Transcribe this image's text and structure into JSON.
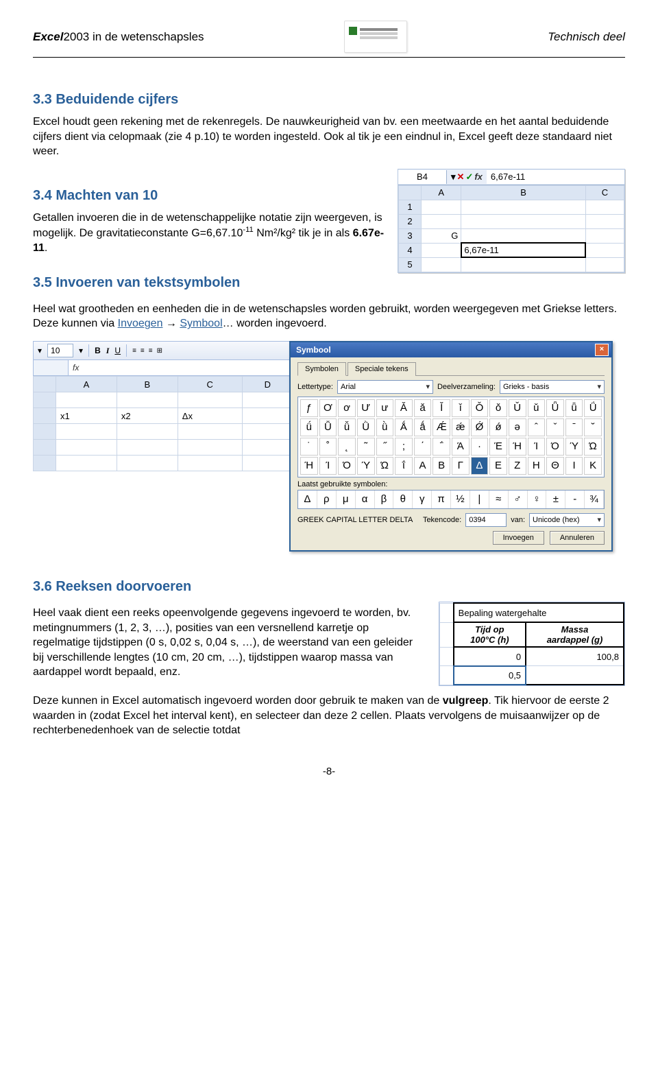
{
  "header": {
    "left_prefix": "Excel",
    "left_year": "2003",
    "left_suffix": " in de wetenschapsles",
    "right": "Technisch deel"
  },
  "sections": {
    "s33_title": "3.3 Beduidende cijfers",
    "s33_p1": "Excel houdt geen rekening met de rekenregels. De nauwkeurigheid van bv. een meetwaarde en het aantal beduidende cijfers dient via celopmaak (zie 4 p.10) te worden ingesteld. Ook al tik je een eindnul in, Excel geeft deze standaard niet weer.",
    "s34_title": "3.4 Machten van 10",
    "s34_p1_a": "Getallen invoeren die in de wetenschappelijke notatie zijn weergeven, is mogelijk. De gravitatieconstante G=6,67.10",
    "s34_p1_sup": "-11",
    "s34_p1_b": " Nm²/kg² tik je in als ",
    "s34_p1_c": "6.67e-11",
    "s34_p1_d": ".",
    "s35_title": "3.5 Invoeren van tekstsymbolen",
    "s35_p1_a": "Heel wat grootheden en eenheden die in de wetenschapsles worden gebruikt, worden weergegeven met Griekse letters. Deze kunnen via ",
    "s35_link1": "Invoegen",
    "s35_arrow": " → ",
    "s35_link2": "Symbool",
    "s35_p1_b": "… worden ingevoerd.",
    "s36_title": "3.6 Reeksen doorvoeren",
    "s36_p1": "Heel vaak dient een reeks opeenvolgende gegevens ingevoerd te worden, bv. metingnummers (1, 2, 3, …), posities van een versnellend karretje op regelmatige tijdstippen (0 s, 0,02 s, 0,04 s, …), de weerstand van een geleider bij verschillende lengtes (10 cm, 20 cm, …), tijdstippen waarop massa van aardappel wordt bepaald, enz.",
    "s36_p2_a": "Deze kunnen in Excel automatisch ingevoerd worden door gebruik te maken van de ",
    "s36_p2_b": "vulgreep",
    "s36_p2_c": ". Tik hiervoor de eerste 2 waarden in (zodat Excel het interval kent), en selecteer dan deze 2 cellen. Plaats vervolgens de muisaanwijzer op de rechterbenedenhoek van de selectie totdat"
  },
  "excel1": {
    "namebox": "B4",
    "formula_value": "6,67e-11",
    "cols": [
      "A",
      "B",
      "C"
    ],
    "rows": [
      "1",
      "2",
      "3",
      "4",
      "5"
    ],
    "cell_a3": "G",
    "cell_b4": "6,67e-11"
  },
  "toolbar": {
    "fontsize": "10",
    "B": "B",
    "I": "I",
    "U": "U",
    "cols": [
      "A",
      "B",
      "C",
      "D"
    ],
    "cell_a": "x1",
    "cell_b": "x2",
    "cell_c": "Δx"
  },
  "dialog": {
    "title": "Symbool",
    "tab1": "Symbolen",
    "tab2": "Speciale tekens",
    "lbl_font": "Lettertype:",
    "val_font": "Arial",
    "lbl_subset": "Deelverzameling:",
    "val_subset": "Grieks - basis",
    "grid": [
      [
        "ƒ",
        "Ơ",
        "ơ",
        "Ư",
        "ư",
        "Ǎ",
        "ǎ",
        "Ǐ",
        "ǐ",
        "Ǒ",
        "ǒ",
        "Ǔ",
        "ǔ",
        "Ǖ",
        "ǖ",
        "Ǘ"
      ],
      [
        "ǘ",
        "Ǚ",
        "ǚ",
        "Ǜ",
        "ǜ",
        "Ǻ",
        "ǻ",
        "Ǽ",
        "ǽ",
        "Ǿ",
        "ǿ",
        "ə",
        "ˆ",
        "ˇ",
        "ˉ",
        "˘"
      ],
      [
        "˙",
        "˚",
        "˛",
        "˜",
        "˝",
        ";",
        "΄",
        "΅",
        "Ά",
        "·",
        "Έ",
        "Ή",
        "Ί",
        "Ό",
        "Ύ",
        "Ώ"
      ],
      [
        "Ή",
        "Ί",
        "Ό",
        "Ύ",
        "Ώ",
        "ΐ",
        "Α",
        "Β",
        "Γ",
        "Δ",
        "Ε",
        "Ζ",
        "Η",
        "Θ",
        "Ι",
        "Κ"
      ]
    ],
    "selected_index": [
      3,
      9
    ],
    "lbl_recent": "Laatst gebruikte symbolen:",
    "recent": [
      "Δ",
      "ρ",
      "μ",
      "α",
      "β",
      "θ",
      "γ",
      "π",
      "½",
      "|",
      "≈",
      "♂",
      "♀",
      "±",
      "-",
      "¾"
    ],
    "lbl_name": "GREEK CAPITAL LETTER DELTA",
    "lbl_code": "Tekencode:",
    "val_code": "0394",
    "lbl_from": "van:",
    "val_from": "Unicode (hex)",
    "btn_insert": "Invoegen",
    "btn_cancel": "Annuleren"
  },
  "excel3": {
    "title": "Bepaling watergehalte",
    "h1_a": "Tijd op",
    "h1_b": "100°C (h)",
    "h2_a": "Massa",
    "h2_b": "aardappel (g)",
    "r1c1": "0",
    "r1c2": "100,8",
    "r2c1": "0,5"
  },
  "footer": "-8-"
}
